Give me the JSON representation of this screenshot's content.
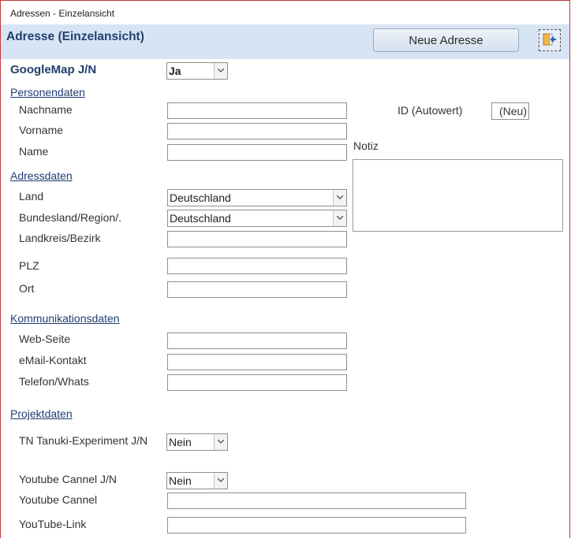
{
  "window": {
    "title": "Adressen - Einzelansicht"
  },
  "header": {
    "title": "Adresse (Einzelansicht)",
    "new_button": "Neue Adresse",
    "exit_icon": "exit-door-icon"
  },
  "googlemap": {
    "label": "GoogleMap J/N",
    "value": "Ja"
  },
  "personendaten": {
    "section": "Personendaten",
    "nachname": {
      "label": "Nachname",
      "value": ""
    },
    "vorname": {
      "label": "Vorname",
      "value": ""
    },
    "name": {
      "label": "Name",
      "value": ""
    }
  },
  "id": {
    "label": "ID (Autowert)",
    "value": "(Neu)"
  },
  "notiz": {
    "label": "Notiz",
    "value": ""
  },
  "adressdaten": {
    "section": "Adressdaten",
    "land": {
      "label": "Land",
      "value": "Deutschland"
    },
    "bundesland": {
      "label": "Bundesland/Region/.",
      "value": "Deutschland"
    },
    "landkreis": {
      "label": "Landkreis/Bezirk",
      "value": ""
    },
    "plz": {
      "label": "PLZ",
      "value": ""
    },
    "ort": {
      "label": "Ort",
      "value": ""
    }
  },
  "kommunikation": {
    "section": "Kommunikationsdaten",
    "web": {
      "label": "Web-Seite",
      "value": ""
    },
    "email": {
      "label": "eMail-Kontakt",
      "value": ""
    },
    "telefon": {
      "label": "Telefon/Whats",
      "value": ""
    }
  },
  "projekt": {
    "section": "Projektdaten",
    "tn": {
      "label": "TN Tanuki-Experiment J/N",
      "value": "Nein"
    },
    "yt_jn": {
      "label": "Youtube Cannel J/N",
      "value": "Nein"
    },
    "yt_cannel": {
      "label": "Youtube Cannel",
      "value": ""
    },
    "yt_link": {
      "label": "YouTube-Link",
      "value": ""
    }
  }
}
